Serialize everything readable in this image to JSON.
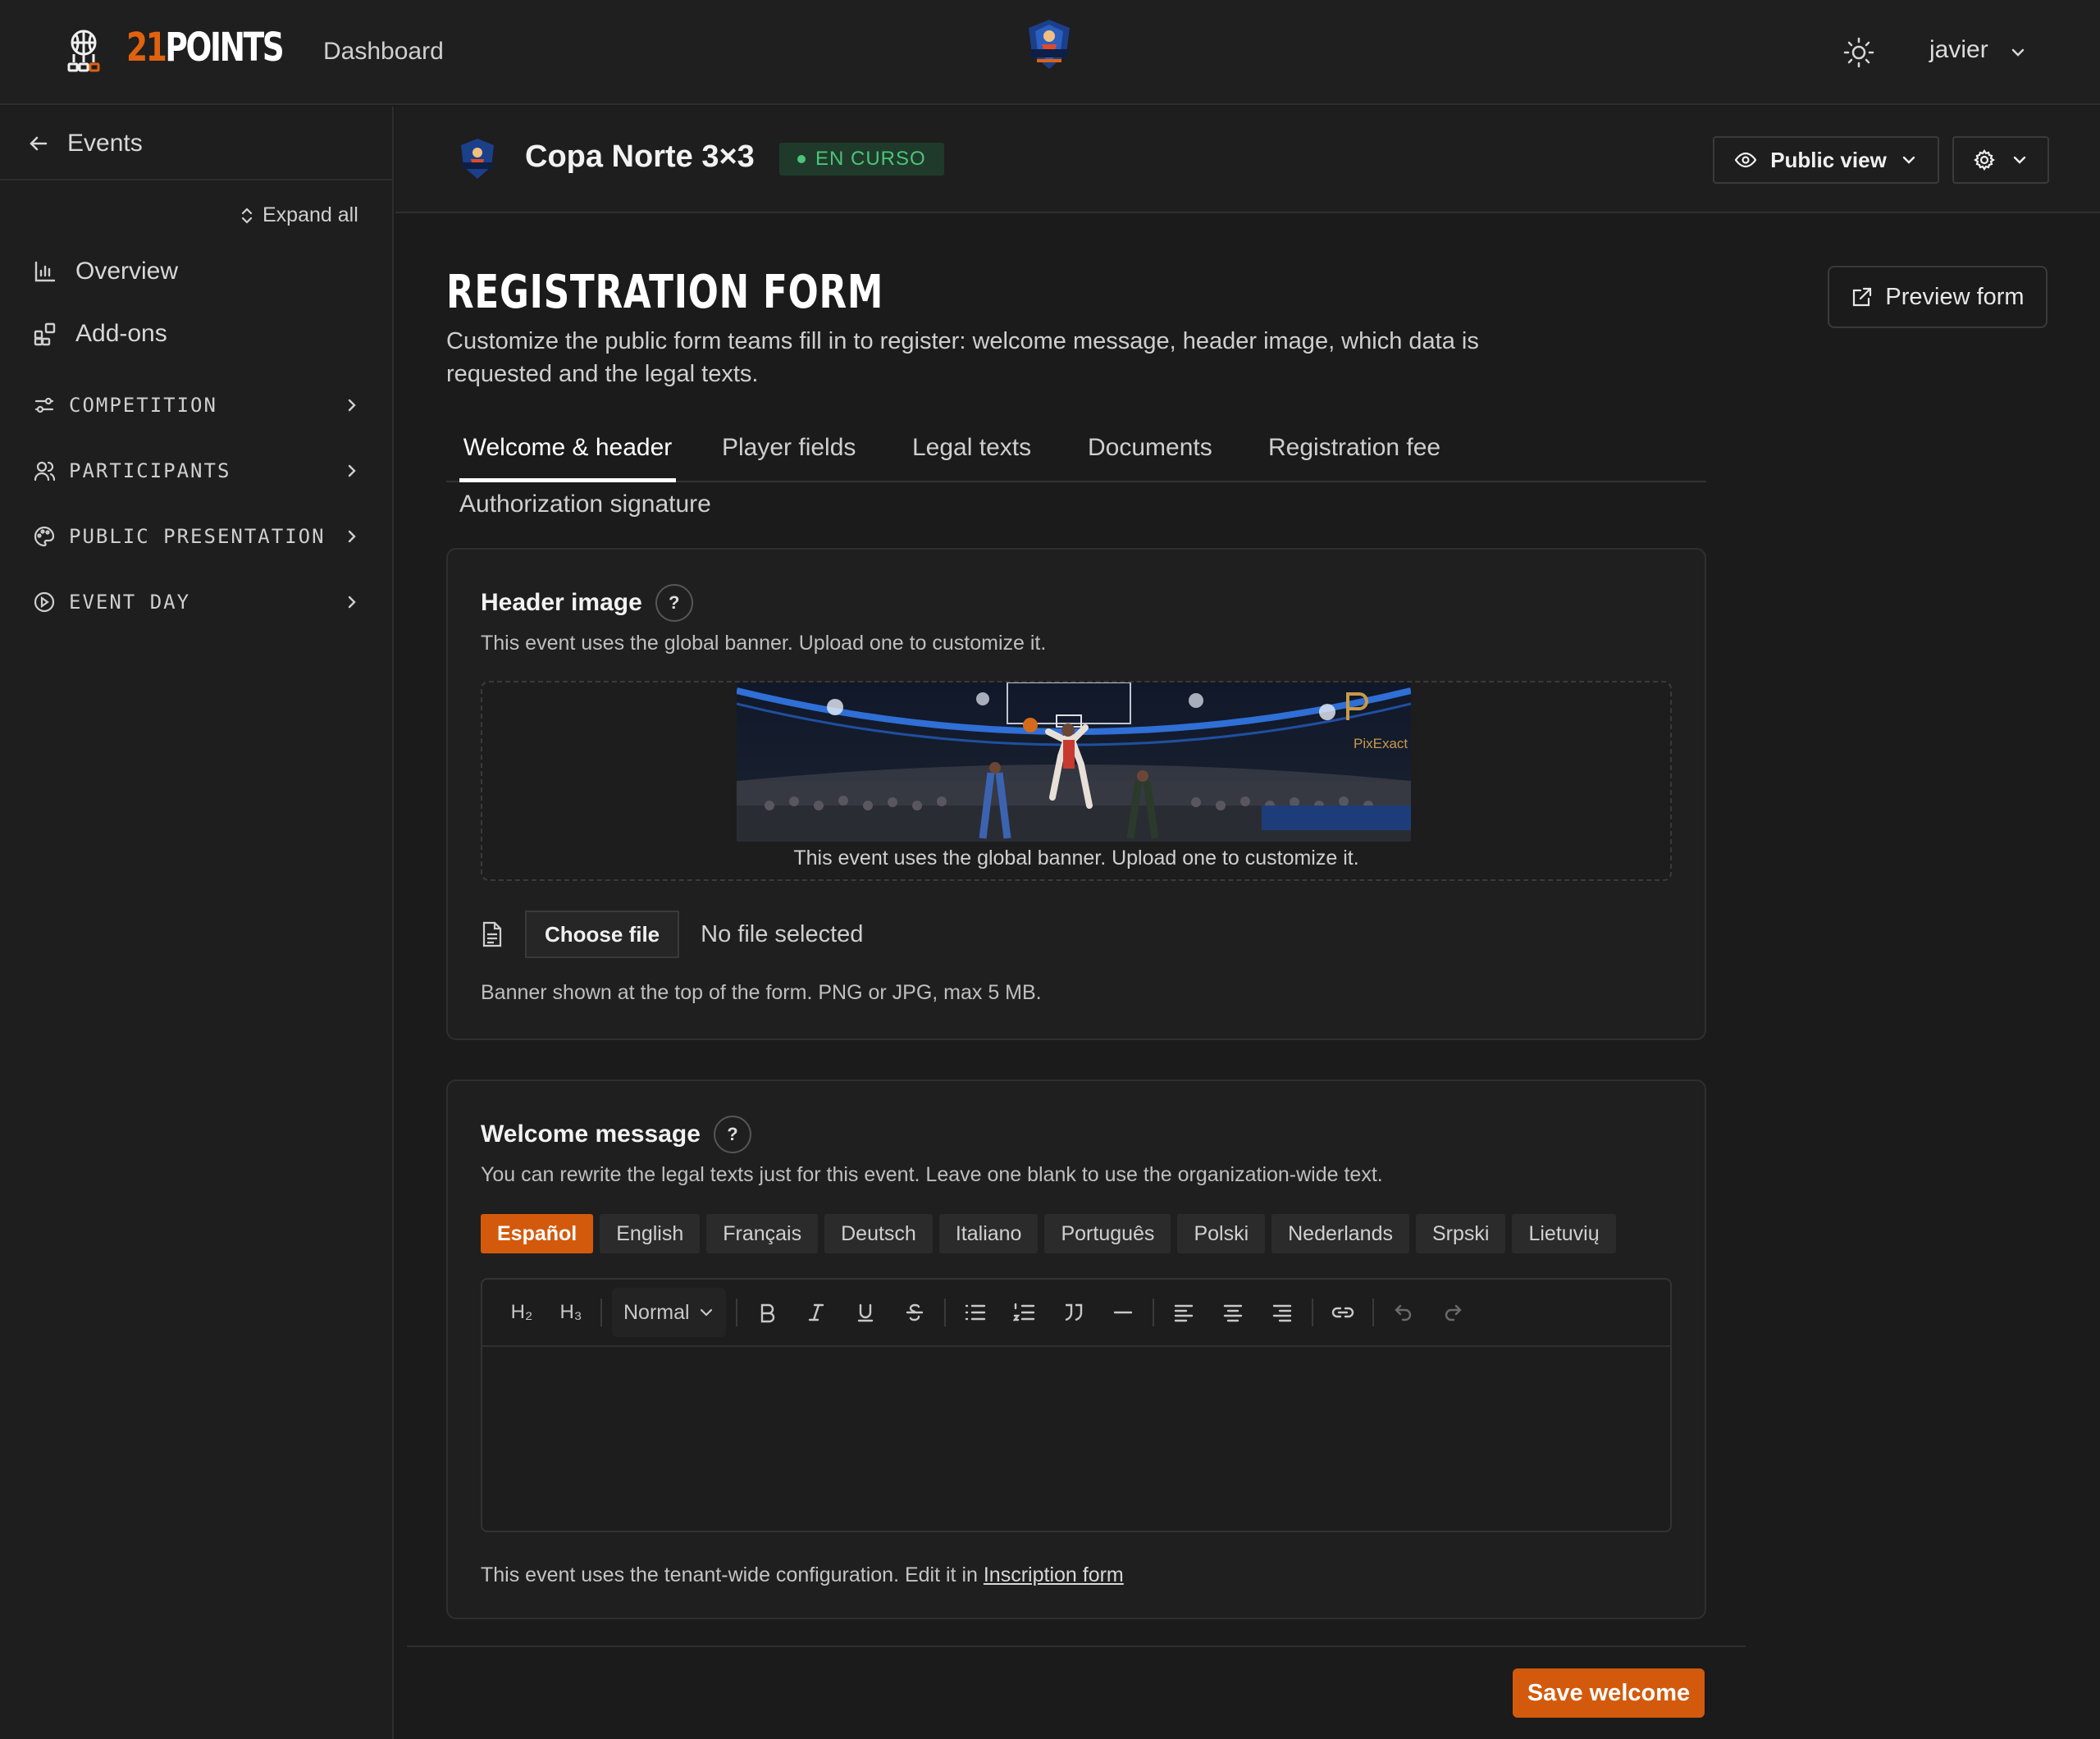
{
  "topbar": {
    "brand_num": "21",
    "brand_word": "POINTS",
    "nav_dashboard": "Dashboard",
    "user_name": "javier"
  },
  "sidebar": {
    "back_label": "Events",
    "expand_all": "Expand all",
    "items": [
      {
        "label": "Overview",
        "icon": "chart-icon"
      },
      {
        "label": "Add-ons",
        "icon": "addons-icon"
      }
    ],
    "groups": [
      {
        "label": "COMPETITION",
        "icon": "sliders-icon"
      },
      {
        "label": "PARTICIPANTS",
        "icon": "users-icon"
      },
      {
        "label": "PUBLIC PRESENTATION",
        "icon": "palette-icon"
      },
      {
        "label": "EVENT DAY",
        "icon": "play-circle-icon"
      }
    ]
  },
  "event": {
    "title": "Copa Norte 3×3",
    "status": "EN CURSO",
    "status_color": "#4cc479",
    "public_view": "Public view"
  },
  "page": {
    "title": "REGISTRATION FORM",
    "description": "Customize the public form teams fill in to register: welcome message, header image, which data is requested and the legal texts.",
    "preview_button": "Preview form",
    "tabs": [
      "Welcome & header",
      "Player fields",
      "Legal texts",
      "Documents",
      "Registration fee",
      "Authorization signature"
    ],
    "active_tab": "Welcome & header"
  },
  "header_image": {
    "title": "Header image",
    "help": "?",
    "subtitle": "This event uses the global banner. Upload one to customize it.",
    "banner_caption": "This event uses the global banner. Upload one to customize it.",
    "banner_watermark": "PixExact",
    "choose_file": "Choose file",
    "no_file": "No file selected",
    "hint": "Banner shown at the top of the form. PNG or JPG, max 5 MB."
  },
  "welcome": {
    "title": "Welcome message",
    "help": "?",
    "subtitle": "You can rewrite the legal texts just for this event. Leave one blank to use the organization-wide text.",
    "languages": [
      "Español",
      "English",
      "Français",
      "Deutsch",
      "Italiano",
      "Português",
      "Polski",
      "Nederlands",
      "Srpski",
      "Lietuvių"
    ],
    "active_language": "Español",
    "toolbar": {
      "h2": "H₂",
      "h3": "H₃",
      "block_type": "Normal"
    },
    "config_note": "This event uses the tenant-wide configuration. Edit it in",
    "config_link": "Inscription form",
    "save_button": "Save welcome"
  },
  "colors": {
    "accent": "#d35a0c",
    "brand_orange": "#e0620f",
    "background": "#1b1b1b"
  }
}
